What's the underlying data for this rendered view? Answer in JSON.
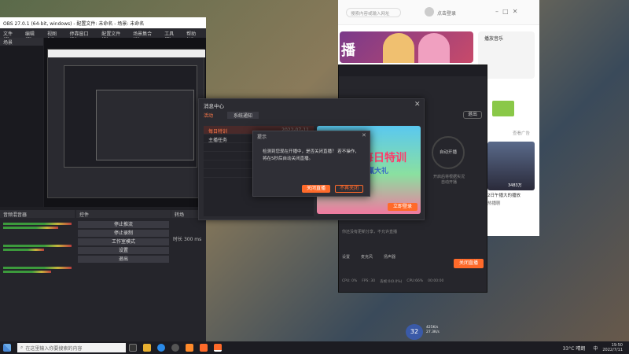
{
  "obs": {
    "title": "OBS 27.0.1 (64-bit, windows) - 配置文件: 未命名 - 场景: 未命名",
    "menu": [
      "文件(F)",
      "编辑(E)",
      "视图(V)",
      "停靠窗口(D)",
      "配置文件(P)",
      "场景集合(S)",
      "工具(T)",
      "帮助(H)"
    ],
    "scenes_header": "场景",
    "mixer_header": "音频混音器",
    "controls_header": "控件",
    "transition_header": "转场",
    "controls": [
      "停止推流",
      "停止录制",
      "工作室模式",
      "设置",
      "退出"
    ],
    "duration_label": "时长",
    "duration_value": "300 ms"
  },
  "browser": {
    "search_placeholder": "搜索内容或输入网址",
    "user": "点击登录",
    "promo_label": "播放音乐",
    "live_banner": "播",
    "ad_label": "查看广告",
    "video_views": "3483万",
    "video_caption": "2日午播大的播放",
    "video_sub": "热播剧"
  },
  "stream": {
    "status_btn": "退出",
    "circle_text": "自动开播",
    "circle_sub1": "开启后将根据实况",
    "circle_sub2": "自动开播",
    "bottom_labels": [
      "设置",
      "麦克风",
      "扬声器"
    ],
    "start_btn": "关闭直播",
    "stats": [
      "CPU: 0%",
      "FPS: 30",
      "丢帧:0(0.0%)",
      "CPU:66%"
    ],
    "time": "00:00:00",
    "hint": "你还没有更新分享，不允许直播"
  },
  "message_center": {
    "title": "消息中心",
    "tabs": [
      "活动",
      "系统通知"
    ],
    "items": [
      "每日特训",
      "主播任务",
      "",
      "",
      "",
      ""
    ],
    "item_time": "2022-07-11",
    "promo_title": "每日特训",
    "promo_sub": "赢大礼",
    "promo_btn": "立即登录"
  },
  "confirm": {
    "title": "提示",
    "line1": "检测到您现在开播中，是否关闭直播？ 若不操作，",
    "line2": "将在5秒后自动关闭直播。",
    "btn_close": "关闭直播",
    "btn_cancel": "不再关闭"
  },
  "taskbar": {
    "search_text": "在这里输入你要搜索的内容",
    "weather": "33°C 晴朗",
    "time": "19:50",
    "date": "2022/7/11",
    "ime": "中"
  },
  "speed_widget": {
    "value": "32",
    "unit": "%",
    "up": "425K/s",
    "down": "27.3K/s"
  },
  "colors": {
    "accent": "#ff6a2a",
    "dark_bg": "#26262c"
  }
}
